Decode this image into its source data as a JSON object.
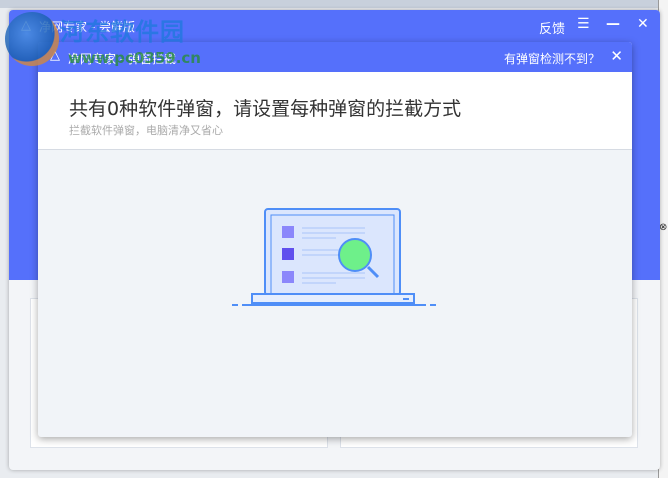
{
  "main_window": {
    "title": "净网专家 - 尝鲜版",
    "feedback_label": "反馈",
    "menu_icon": "☰",
    "minimize_icon": "—",
    "close_icon": "✕"
  },
  "dialog": {
    "title": "净网专家 - 弹窗拦截",
    "help_link": "有弹窗检测不到？",
    "close_icon": "✕",
    "heading": "共有0种软件弹窗，请设置每种弹窗的拦截方式",
    "subheading": "拦截软件弹窗，电脑清净又省心"
  },
  "watermark": {
    "name": "河东软件园",
    "url": "www.pc0359.cn"
  },
  "side_glyph": "⊗",
  "colors": {
    "brand": "#5570fb",
    "accent_green": "#6ef08a"
  }
}
